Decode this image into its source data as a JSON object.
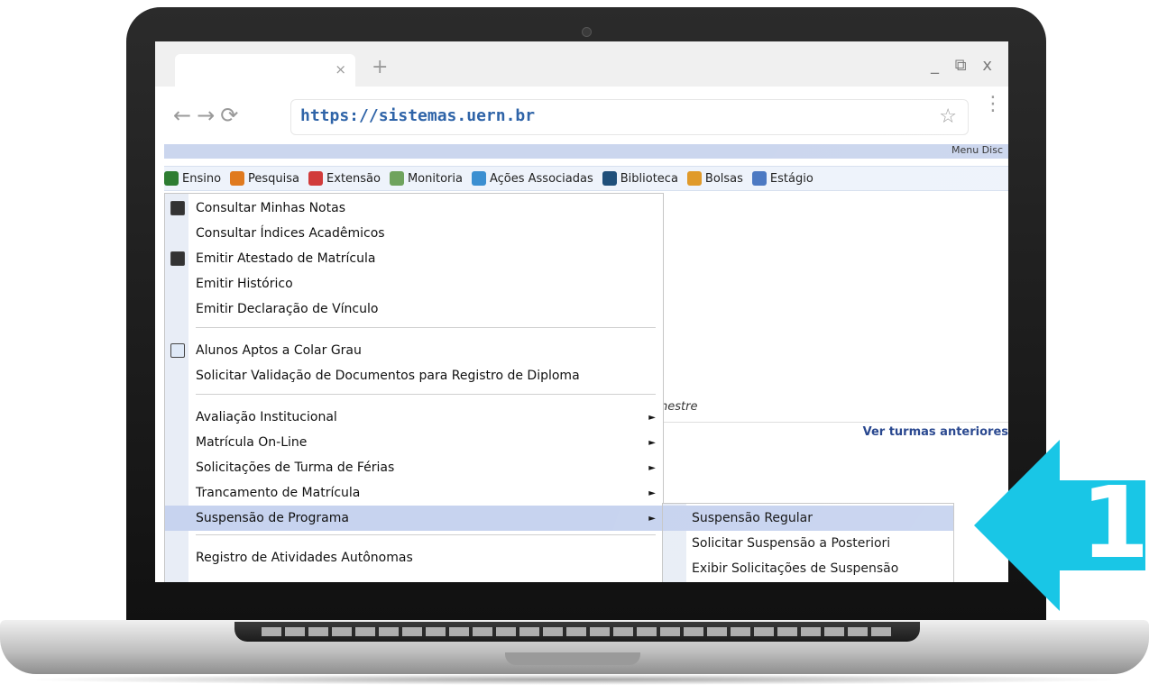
{
  "browser": {
    "url": "https://sistemas.uern.br",
    "tab_close": "×",
    "new_tab": "+",
    "window_controls": "_ ⧉ x",
    "nav_glyphs": "←→⟳",
    "star": "☆",
    "kebab": "⋮"
  },
  "page": {
    "menu_disc_label": "Menu Disc",
    "menubar": [
      {
        "label": "Ensino",
        "icon": "books-icon",
        "color": "#2e7d32"
      },
      {
        "label": "Pesquisa",
        "icon": "flask-icon",
        "color": "#e07a1f"
      },
      {
        "label": "Extensão",
        "icon": "heart-hands-icon",
        "color": "#d13b3b"
      },
      {
        "label": "Monitoria",
        "icon": "monitor-icon",
        "color": "#6fa35d"
      },
      {
        "label": "Ações Associadas",
        "icon": "puzzle-icon",
        "color": "#3b8fd1"
      },
      {
        "label": "Biblioteca",
        "icon": "library-icon",
        "color": "#1f4f7a"
      },
      {
        "label": "Bolsas",
        "icon": "person-icon",
        "color": "#e09a2a"
      },
      {
        "label": "Estágio",
        "icon": "badge-icon",
        "color": "#4a78c2"
      }
    ],
    "bg_text": "nestre",
    "bg_link": "Ver turmas anteriores"
  },
  "dropdown": {
    "items": [
      {
        "label": "Consultar Minhas Notas",
        "icon": "phone-icon"
      },
      {
        "label": "Consultar Índices Acadêmicos"
      },
      {
        "label": "Emitir Atestado de Matrícula",
        "icon": "phone-icon"
      },
      {
        "label": "Emitir Histórico"
      },
      {
        "label": "Emitir Declaração de Vínculo"
      },
      {
        "label": "Alunos Aptos a Colar Grau",
        "icon": "window-icon"
      },
      {
        "label": "Solicitar Validação de Documentos para Registro de Diploma"
      },
      {
        "label": "Avaliação Institucional",
        "arrow": "►"
      },
      {
        "label": "Matrícula On-Line",
        "arrow": "►"
      },
      {
        "label": "Solicitações de Turma de Férias",
        "arrow": "►"
      },
      {
        "label": "Trancamento de Matrícula",
        "arrow": "►"
      },
      {
        "label": "Suspensão de Programa",
        "arrow": "►",
        "selected": true
      },
      {
        "label": "Registro de Atividades Autônomas"
      }
    ]
  },
  "submenu": {
    "items": [
      {
        "label": "Suspensão Regular",
        "selected": true
      },
      {
        "label": "Solicitar Suspensão a Posteriori"
      },
      {
        "label": "Exibir Solicitações de Suspensão"
      }
    ]
  },
  "callout": {
    "number": "1",
    "color": "#19c6e6"
  }
}
